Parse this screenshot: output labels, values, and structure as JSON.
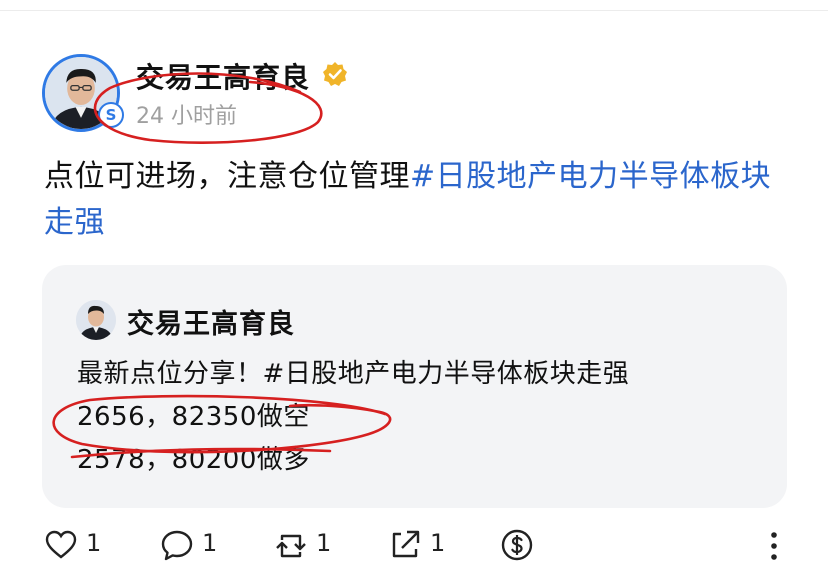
{
  "post": {
    "author": "交易王高育良",
    "timestamp": "24 小时前",
    "text": "点位可进场，注意仓位管理",
    "hashtag": "#日股地产电力半导体板块走强",
    "badge_letter": "S"
  },
  "quote": {
    "author": "交易王高育良",
    "line1": "最新点位分享！#日股地产电力半导体板块走强",
    "line2": "2656，82350做空",
    "line3": "2578，80200做多"
  },
  "actions": {
    "like_count": "1",
    "reply_count": "1",
    "quote_count": "1",
    "share_count": "1"
  },
  "colors": {
    "accent_blue": "#2b66cc",
    "verified_gold": "#f0b429",
    "annotation_red": "#d62020"
  }
}
